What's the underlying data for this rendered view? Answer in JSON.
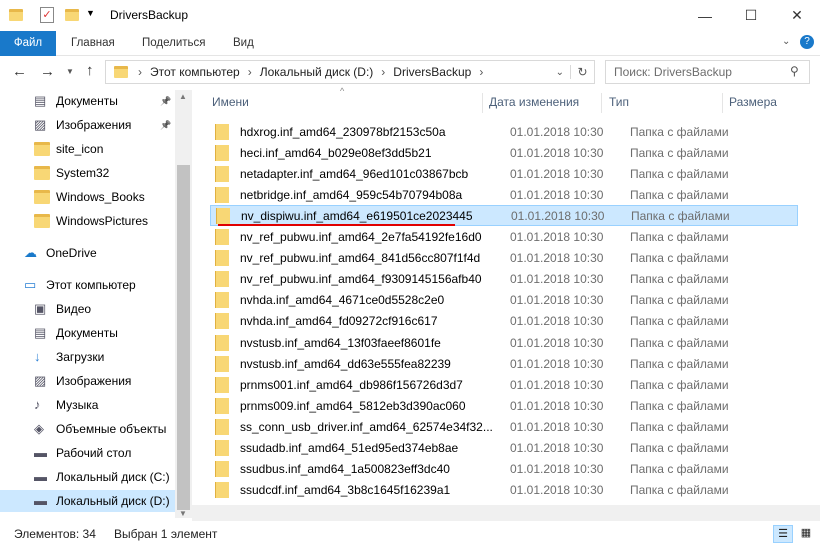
{
  "window": {
    "title": "DriversBackup",
    "minimize": "—",
    "maximize": "☐",
    "close": "✕"
  },
  "ribbon": {
    "tabs": [
      "Файл",
      "Главная",
      "Поделиться",
      "Вид"
    ]
  },
  "address": {
    "path": [
      "Этот компьютер",
      "Локальный диск (D:)",
      "DriversBackup"
    ],
    "search_placeholder": "Поиск: DriversBackup"
  },
  "sidebar": {
    "items": [
      {
        "label": "Документы",
        "icon": "documents-icon",
        "pinned": true
      },
      {
        "label": "Изображения",
        "icon": "pictures-icon",
        "pinned": true
      },
      {
        "label": "site_icon",
        "icon": "folder-icon"
      },
      {
        "label": "System32",
        "icon": "folder-icon"
      },
      {
        "label": "Windows_Books",
        "icon": "folder-icon"
      },
      {
        "label": "WindowsPictures",
        "icon": "folder-icon"
      },
      {
        "label": "OneDrive",
        "icon": "cloud-icon"
      },
      {
        "label": "Этот компьютер",
        "icon": "computer-icon"
      },
      {
        "label": "Видео",
        "icon": "video-icon"
      },
      {
        "label": "Документы",
        "icon": "documents-icon"
      },
      {
        "label": "Загрузки",
        "icon": "downloads-icon"
      },
      {
        "label": "Изображения",
        "icon": "pictures-icon"
      },
      {
        "label": "Музыка",
        "icon": "music-icon"
      },
      {
        "label": "Объемные объекты",
        "icon": "3d-objects-icon"
      },
      {
        "label": "Рабочий стол",
        "icon": "desktop-icon"
      },
      {
        "label": "Локальный диск (C:)",
        "icon": "drive-icon"
      },
      {
        "label": "Локальный диск (D:)",
        "icon": "drive-icon",
        "selected": true
      }
    ]
  },
  "columns": {
    "name": "Имени",
    "date": "Дата изменения",
    "type": "Тип",
    "size": "Размера"
  },
  "files": [
    {
      "name": "hdxrog.inf_amd64_230978bf2153c50a",
      "date": "01.01.2018 10:30",
      "type": "Папка с файлами"
    },
    {
      "name": "heci.inf_amd64_b029e08ef3dd5b21",
      "date": "01.01.2018 10:30",
      "type": "Папка с файлами"
    },
    {
      "name": "netadapter.inf_amd64_96ed101c03867bcb",
      "date": "01.01.2018 10:30",
      "type": "Папка с файлами"
    },
    {
      "name": "netbridge.inf_amd64_959c54b70794b08a",
      "date": "01.01.2018 10:30",
      "type": "Папка с файлами"
    },
    {
      "name": "nv_dispiwu.inf_amd64_e619501ce2023445",
      "date": "01.01.2018 10:30",
      "type": "Папка с файлами",
      "selected": true
    },
    {
      "name": "nv_ref_pubwu.inf_amd64_2e7fa54192fe16d0",
      "date": "01.01.2018 10:30",
      "type": "Папка с файлами"
    },
    {
      "name": "nv_ref_pubwu.inf_amd64_841d56cc807f1f4d",
      "date": "01.01.2018 10:30",
      "type": "Папка с файлами"
    },
    {
      "name": "nv_ref_pubwu.inf_amd64_f9309145156afb40",
      "date": "01.01.2018 10:30",
      "type": "Папка с файлами"
    },
    {
      "name": "nvhda.inf_amd64_4671ce0d5528c2e0",
      "date": "01.01.2018 10:30",
      "type": "Папка с файлами"
    },
    {
      "name": "nvhda.inf_amd64_fd09272cf916c617",
      "date": "01.01.2018 10:30",
      "type": "Папка с файлами"
    },
    {
      "name": "nvstusb.inf_amd64_13f03faeef8601fe",
      "date": "01.01.2018 10:30",
      "type": "Папка с файлами"
    },
    {
      "name": "nvstusb.inf_amd64_dd63e555fea82239",
      "date": "01.01.2018 10:30",
      "type": "Папка с файлами"
    },
    {
      "name": "prnms001.inf_amd64_db986f156726d3d7",
      "date": "01.01.2018 10:30",
      "type": "Папка с файлами"
    },
    {
      "name": "prnms009.inf_amd64_5812eb3d390ac060",
      "date": "01.01.2018 10:30",
      "type": "Папка с файлами"
    },
    {
      "name": "ss_conn_usb_driver.inf_amd64_62574e34f32...",
      "date": "01.01.2018 10:30",
      "type": "Папка с файлами"
    },
    {
      "name": "ssudadb.inf_amd64_51ed95ed374eb8ae",
      "date": "01.01.2018 10:30",
      "type": "Папка с файлами"
    },
    {
      "name": "ssudbus.inf_amd64_1a500823eff3dc40",
      "date": "01.01.2018 10:30",
      "type": "Папка с файлами"
    },
    {
      "name": "ssudcdf.inf_amd64_3b8c1645f16239a1",
      "date": "01.01.2018 10:30",
      "type": "Папка с файлами"
    }
  ],
  "status": {
    "count": "Элементов: 34",
    "selected": "Выбран 1 элемент"
  },
  "colors": {
    "accent": "#1979ca",
    "selection": "#cce8ff",
    "underline": "#e00000"
  }
}
